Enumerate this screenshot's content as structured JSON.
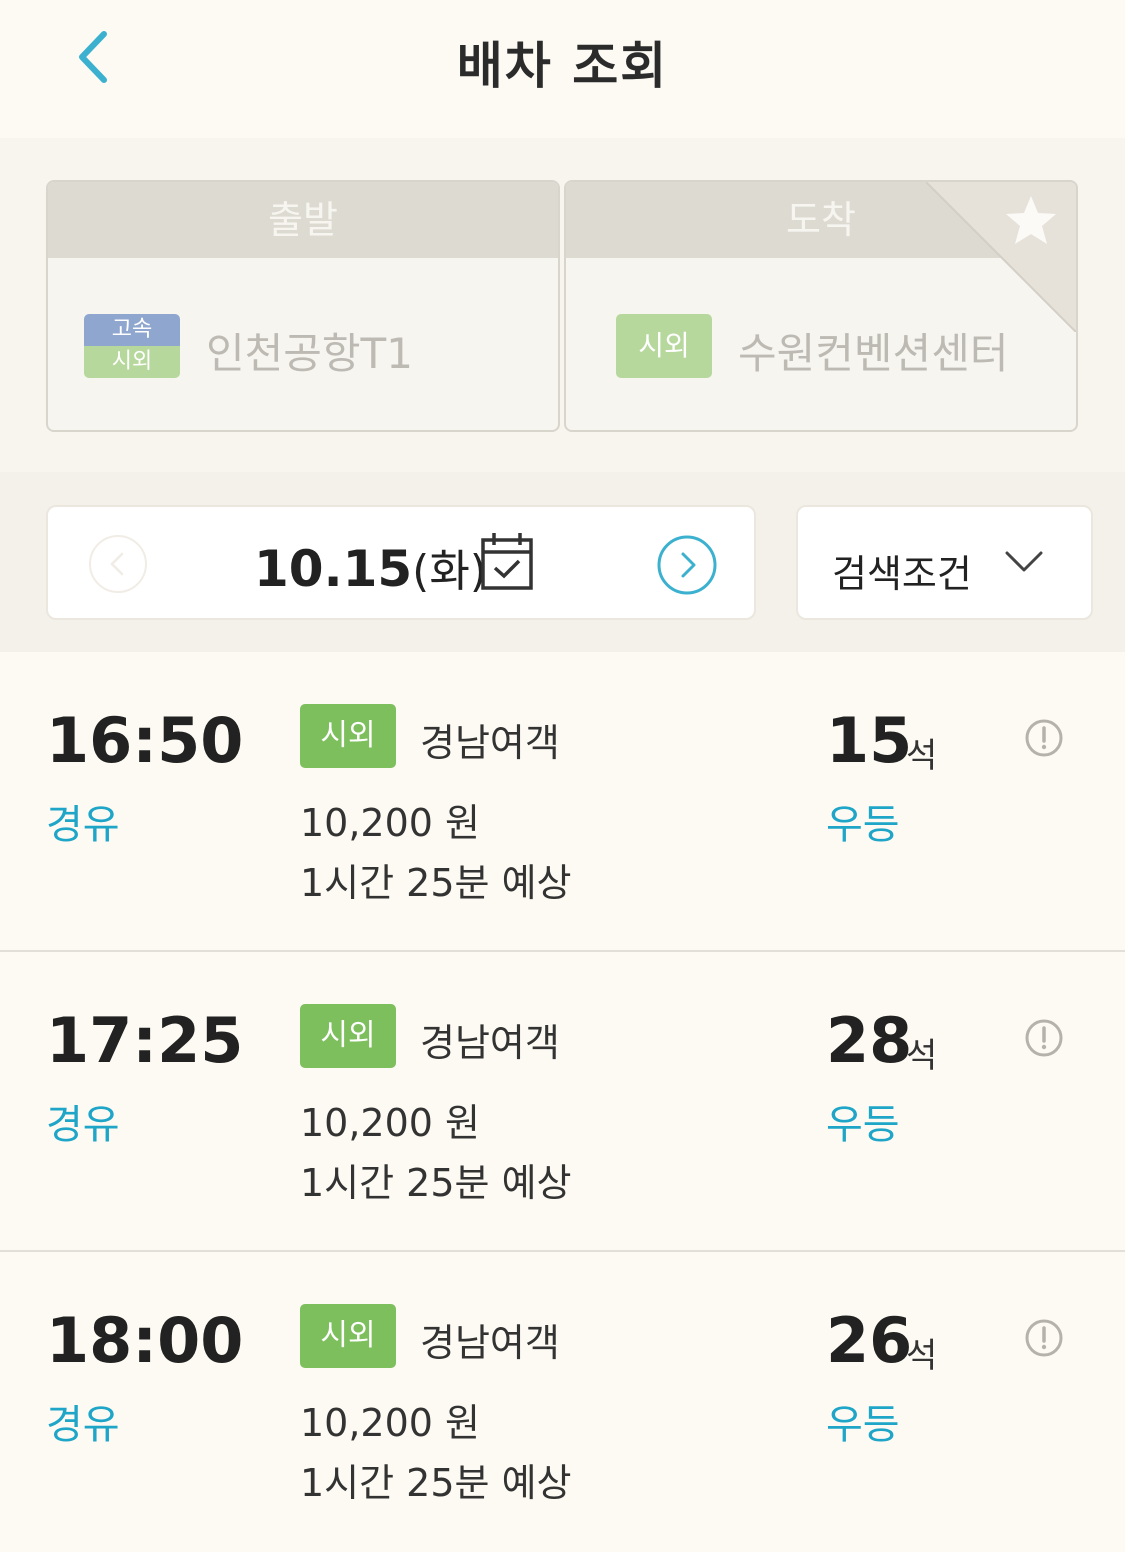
{
  "header": {
    "title": "배차 조회"
  },
  "route": {
    "departure": {
      "label": "출발",
      "badge_top": "고속",
      "badge_bottom": "시외",
      "station": "인천공항T1"
    },
    "arrival": {
      "label": "도착",
      "badge": "시외",
      "station": "수원컨벤션센터"
    }
  },
  "date_bar": {
    "date": "10.15",
    "weekday": "(화)"
  },
  "search_condition": {
    "label": "검색조건"
  },
  "schedules": [
    {
      "time": "16:50",
      "route_type": "경유",
      "bus_type": "시외",
      "company": "경남여객",
      "fare": "10,200 원",
      "duration": "1시간 25분 예상",
      "seats": "15",
      "seat_unit": "석",
      "grade": "우등"
    },
    {
      "time": "17:25",
      "route_type": "경유",
      "bus_type": "시외",
      "company": "경남여객",
      "fare": "10,200 원",
      "duration": "1시간 25분 예상",
      "seats": "28",
      "seat_unit": "석",
      "grade": "우등"
    },
    {
      "time": "18:00",
      "route_type": "경유",
      "bus_type": "시외",
      "company": "경남여객",
      "fare": "10,200 원",
      "duration": "1시간 25분 예상",
      "seats": "26",
      "seat_unit": "석",
      "grade": "우등"
    }
  ],
  "colors": {
    "accent": "#1ea5c7",
    "badge_green": "#7cbf5c",
    "badge_blue": "#8fa6cf",
    "background": "#fdfaf3"
  },
  "icons": {
    "back": "chevron-left-icon",
    "favorite": "star-icon",
    "prev_date": "chevron-left-circle-icon",
    "next_date": "chevron-right-circle-icon",
    "calendar": "calendar-check-icon",
    "dropdown": "chevron-down-icon",
    "info": "exclamation-circle-icon"
  }
}
